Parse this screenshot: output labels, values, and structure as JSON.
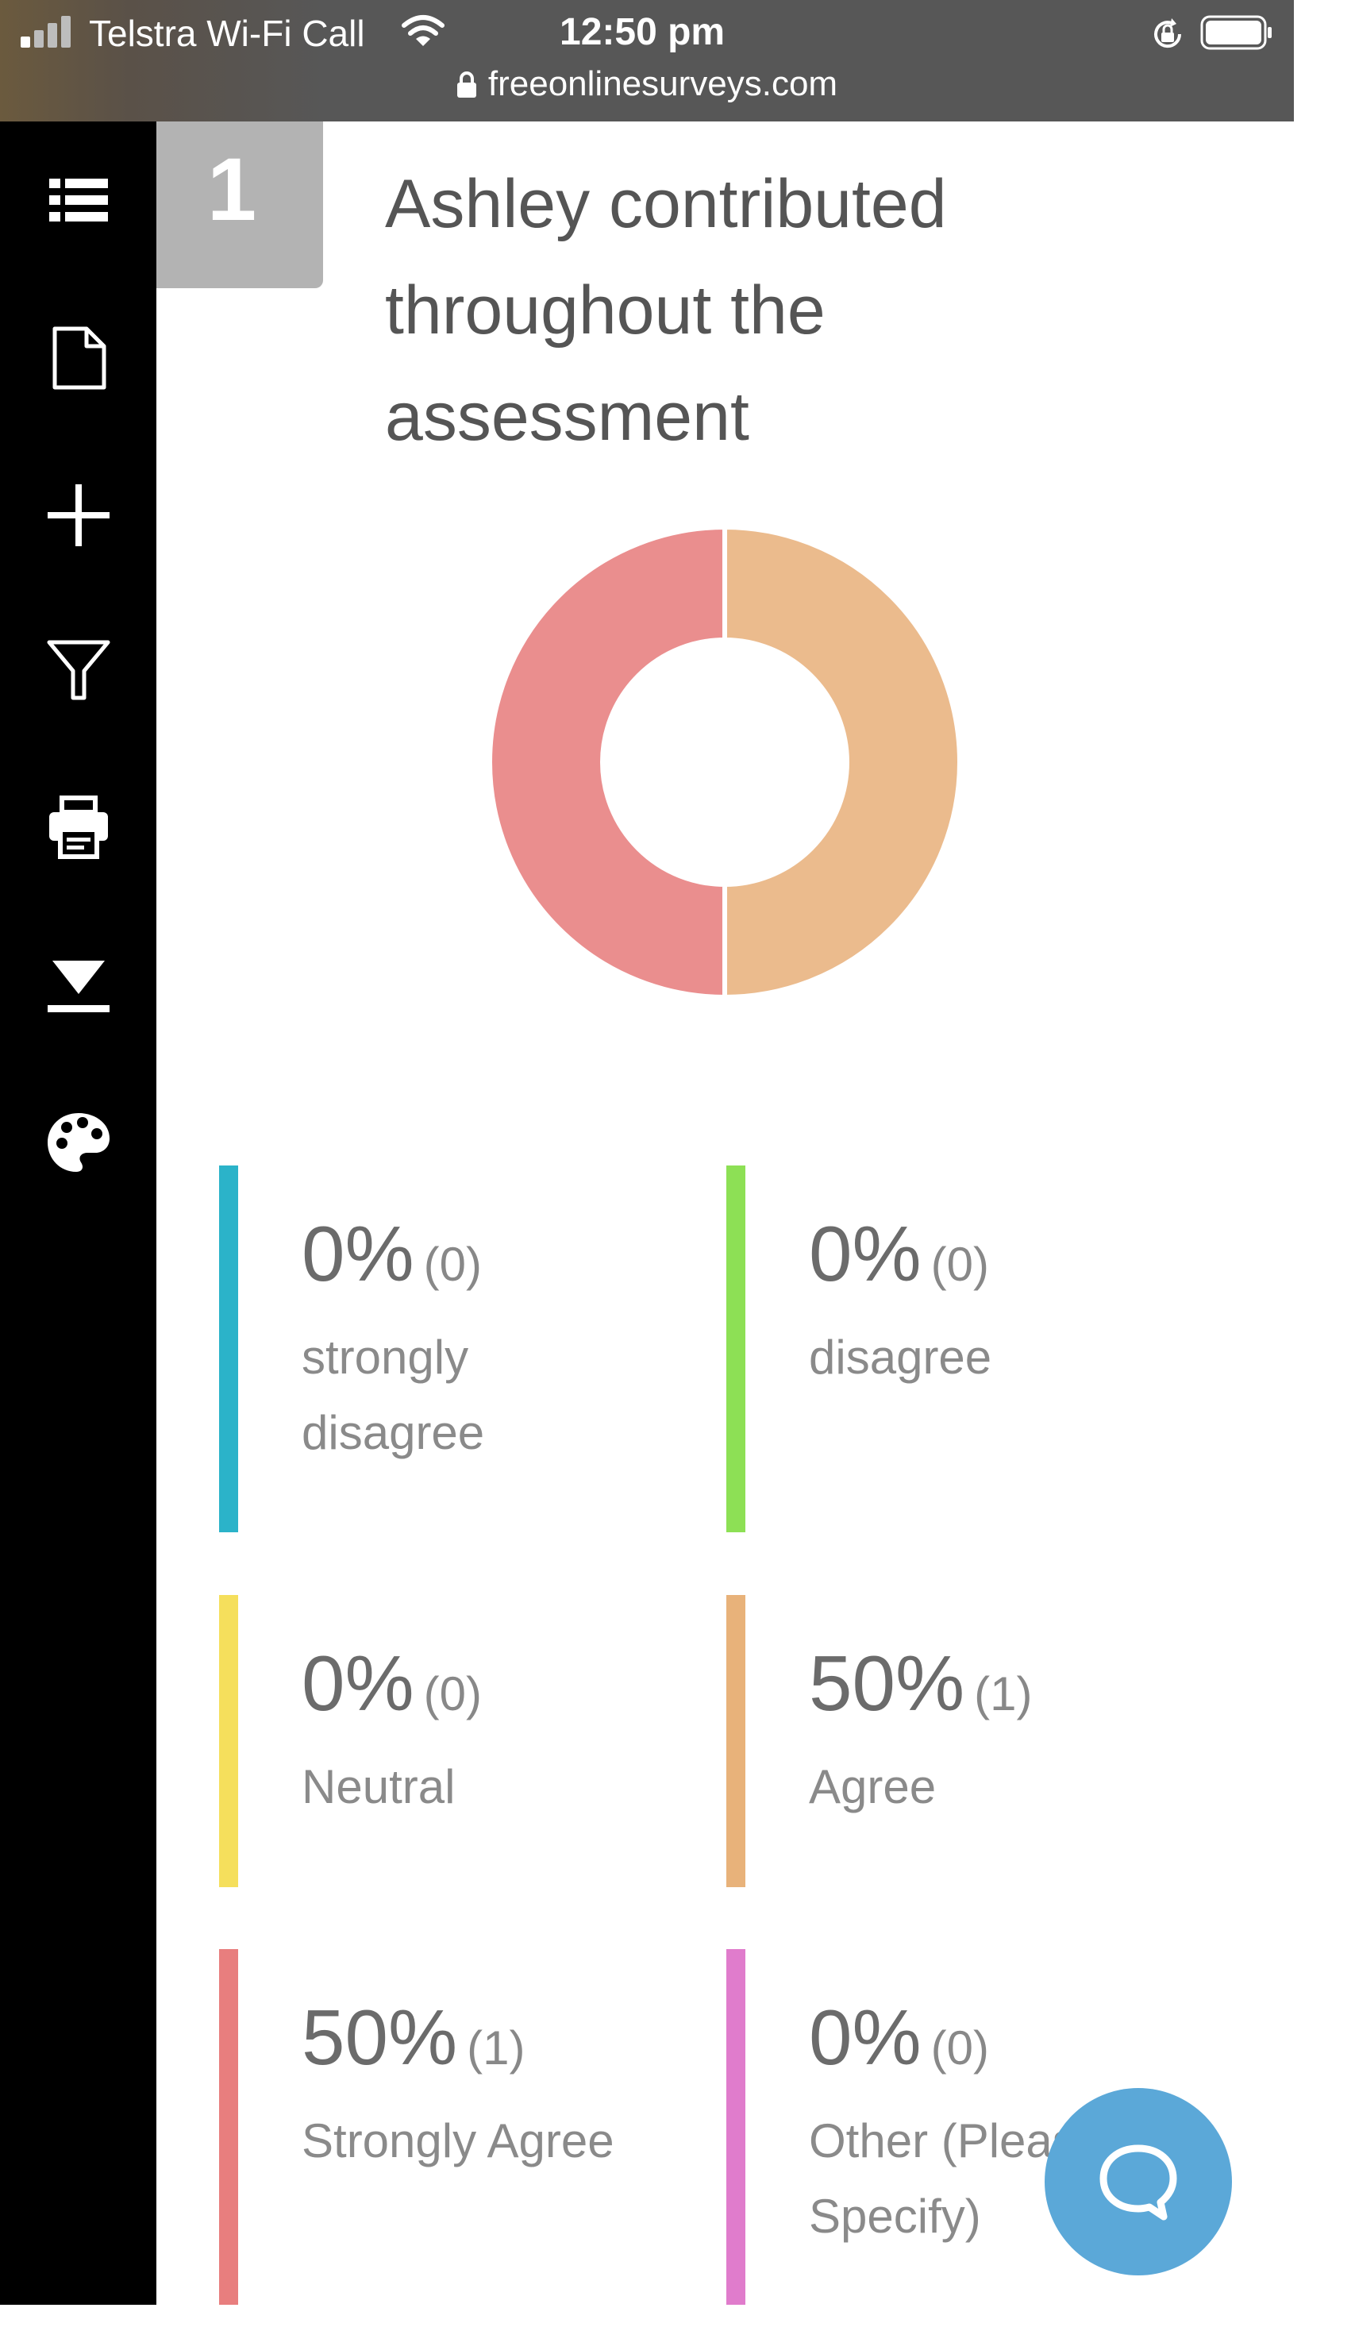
{
  "status_bar": {
    "carrier": "Telstra Wi-Fi Call",
    "time": "12:50 pm",
    "url": "freeonlinesurveys.com",
    "icons": [
      "signal-icon",
      "wifi-icon",
      "rotation-lock-icon",
      "battery-icon",
      "lock-icon"
    ]
  },
  "sidebar": {
    "items": [
      {
        "icon": "list-icon"
      },
      {
        "icon": "document-icon"
      },
      {
        "icon": "plus-icon"
      },
      {
        "icon": "filter-icon"
      },
      {
        "icon": "print-icon"
      },
      {
        "icon": "download-icon"
      },
      {
        "icon": "palette-icon"
      }
    ]
  },
  "question": {
    "number": "1",
    "title": "Ashley contributed throughout the assessment"
  },
  "chart_data": {
    "type": "pie",
    "style": "donut",
    "categories": [
      "strongly disagree",
      "disagree",
      "Neutral",
      "Agree",
      "Strongly Agree",
      "Other (Please Specify)"
    ],
    "values": [
      0,
      0,
      0,
      50,
      50,
      0
    ],
    "counts": [
      0,
      0,
      0,
      1,
      1,
      0
    ],
    "colors": [
      "#2bb3c9",
      "#8de055",
      "#f5df5c",
      "#e8b27a",
      "#e87e7e",
      "#e07ccc"
    ],
    "slice_colors": {
      "Agree": "#ebbb8d",
      "Strongly Agree": "#ea8e8e"
    }
  },
  "legend": [
    {
      "percent": "0%",
      "count": "(0)",
      "label": "strongly disagree",
      "color": "#2bb3c9"
    },
    {
      "percent": "0%",
      "count": "(0)",
      "label": "disagree",
      "color": "#8de055"
    },
    {
      "percent": "0%",
      "count": "(0)",
      "label": "Neutral",
      "color": "#f5df5c"
    },
    {
      "percent": "50%",
      "count": "(1)",
      "label": "Agree",
      "color": "#e8b27a"
    },
    {
      "percent": "50%",
      "count": "(1)",
      "label": "Strongly Agree",
      "color": "#e87e7e"
    },
    {
      "percent": "0%",
      "count": "(0)",
      "label": "Other (Please Specify)",
      "color": "#e07ccc"
    }
  ],
  "chat": {
    "icon": "chat-bubble-icon",
    "color": "#5ba8d8"
  }
}
